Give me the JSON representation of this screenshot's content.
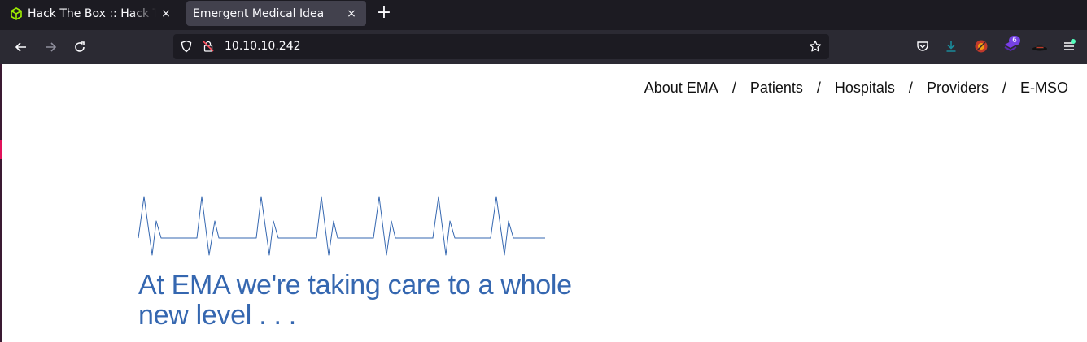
{
  "browser": {
    "tabs": [
      {
        "title": "Hack The Box :: Hack The Box",
        "active": false,
        "favicon": "htb-cube-icon"
      },
      {
        "title": "Emergent Medical Idea",
        "active": true
      }
    ],
    "new_tab_label": "+",
    "close_label": "×",
    "url": "10.10.10.242",
    "extension_badge": "6",
    "colors": {
      "tab_strip": "#1c1b22",
      "toolbar": "#2b2a33",
      "active_tab": "#42414d",
      "badge": "#7542e5"
    }
  },
  "site": {
    "nav": {
      "items": [
        "About EMA",
        "Patients",
        "Hospitals",
        "Providers",
        "E-MSO"
      ],
      "separator": "/"
    },
    "headline": "At EMA we're taking care to a whole new level . . .",
    "colors": {
      "headline": "#3567b0",
      "ecg_line": "#3567b0",
      "nav_text": "#111111"
    }
  }
}
